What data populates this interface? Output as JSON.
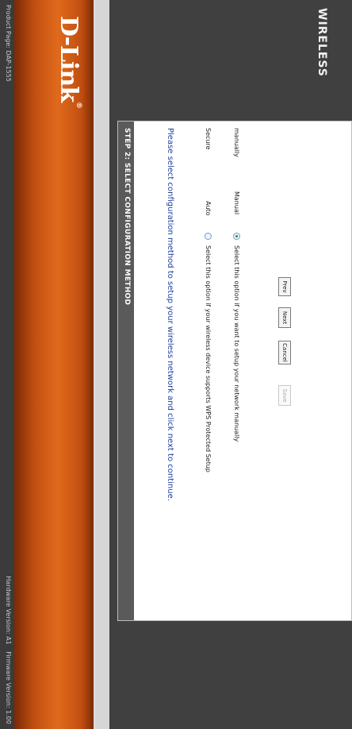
{
  "topbar": {
    "product": "Product Page: DAP-1555",
    "hardware": "Hardware Version: A1",
    "firmware": "Firmware Version: 1.00"
  },
  "banner": {
    "logo": "D-Link",
    "logo_mark": "®"
  },
  "wizard": {
    "title": "STEP 2: SELECT CONFIGURATION METHOD",
    "instruction": "Please select configuration method to setup your wireless network and click next to continue.",
    "row_labels": [
      "Secure",
      "manually"
    ],
    "options": [
      {
        "label": "Auto",
        "description": "Select this option if your wireless device supports WPS Protected Setup",
        "selected": false
      },
      {
        "label": "Manual",
        "description": "Select this option if you want to setup your network manually",
        "selected": true
      }
    ],
    "buttons": [
      "Prev",
      "Next",
      "Cancel",
      "Save"
    ]
  },
  "footer": {
    "wireless": "WIRELESS"
  }
}
